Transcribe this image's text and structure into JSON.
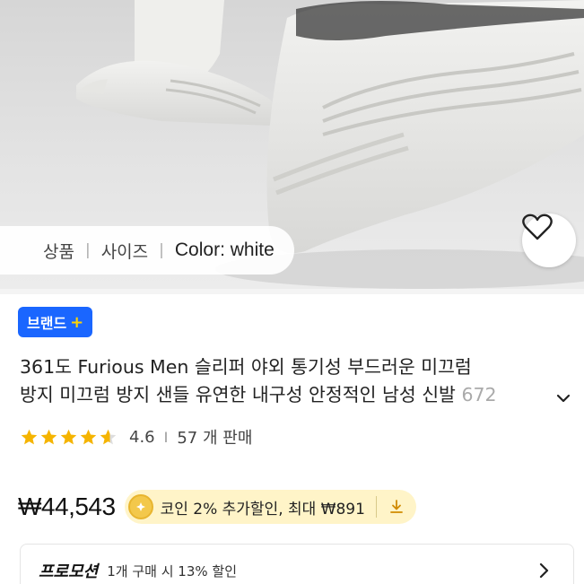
{
  "chips": {
    "item1": "상품",
    "sep1": "|",
    "item2": "사이즈",
    "sep2": "|",
    "color": "Color: white"
  },
  "icons": {
    "wishlist": "heart-outline-icon",
    "expand": "chevron-down-icon",
    "promo_more": "chevron-right-icon",
    "coin": "coin-icon",
    "download": "download-icon",
    "star": "star-icon"
  },
  "brand_badge": {
    "label": "브랜드",
    "plus": "+"
  },
  "product": {
    "title_line1": "361도 Furious Men 슬리퍼 야외 통기성 부드러운 미끄럼",
    "title_line2": "방지 미끄럼 방지 샌들 유연한 내구성 안정적인 남성 신발",
    "title_line2_tail": " 672"
  },
  "rating": {
    "stars": 4.6,
    "score": "4.6",
    "sep": "I",
    "sold": "57 개 판매"
  },
  "price": {
    "value": "₩44,543",
    "coin_text": "코인 2% 추가할인, 최대 ₩891"
  },
  "promo": {
    "title": "프로모션",
    "text": "1개 구매 시 13% 할인"
  },
  "colors": {
    "brand_blue": "#1a66ff",
    "plus_yellow": "#ffd400",
    "star": "#f5b400",
    "coin_bg": "#fff4c8"
  }
}
